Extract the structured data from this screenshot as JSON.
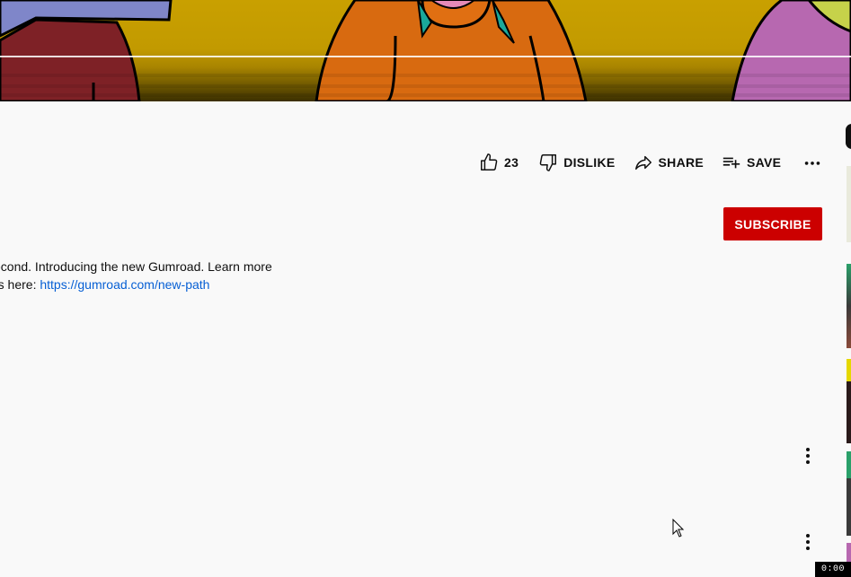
{
  "video": {
    "colors": {
      "sky": "#c9a000",
      "blue_char": "#7f86c9",
      "red_char": "#7e2126",
      "orange_char": "#d86a10",
      "pink_char": "#b768b0",
      "teal": "#1aa89a"
    }
  },
  "actions": {
    "like_count": "23",
    "dislike_label": "DISLIKE",
    "share_label": "SHARE",
    "save_label": "SAVE",
    "icons": [
      "thumb-up-icon",
      "thumb-down-icon",
      "share-arrow-icon",
      "playlist-add-icon",
      "more-horizontal-icon"
    ]
  },
  "channel": {
    "subscribe_label": "SUBSCRIBE",
    "subscribe_color": "#cc0000"
  },
  "description": {
    "line1": "econd. Introducing the new Gumroad. Learn more",
    "line2_prefix": "rs here: ",
    "link": "https://gumroad.com/new-path",
    "link_color": "#065fd4"
  },
  "comments": {
    "icons": [
      "more-vertical-icon",
      "more-vertical-icon"
    ]
  },
  "sidebar": {
    "time_badge": "0:00"
  }
}
